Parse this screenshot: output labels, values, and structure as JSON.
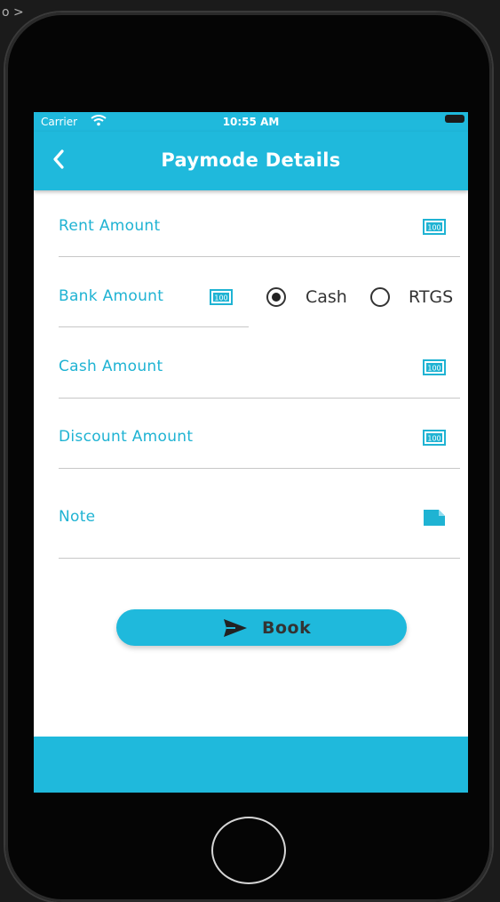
{
  "status_bar": {
    "carrier": "Carrier",
    "time": "10:55 AM"
  },
  "nav": {
    "title": "Paymode Details",
    "back_icon": "chevron-left-icon"
  },
  "form": {
    "rent_amount_label": "Rent Amount",
    "bank_amount_label": "Bank Amount",
    "cash_amount_label": "Cash Amount",
    "discount_amount_label": "Discount Amount",
    "note_label": "Note",
    "field_icon": "money-bill-icon",
    "note_icon": "sticky-note-icon"
  },
  "payment_mode": {
    "options": [
      "Cash",
      "RTGS"
    ],
    "selected": "Cash"
  },
  "book_button": {
    "label": "Book",
    "icon": "send-icon"
  },
  "colors": {
    "accent": "#1fb9dc",
    "label": "#1fb3d3",
    "text": "#333333"
  }
}
